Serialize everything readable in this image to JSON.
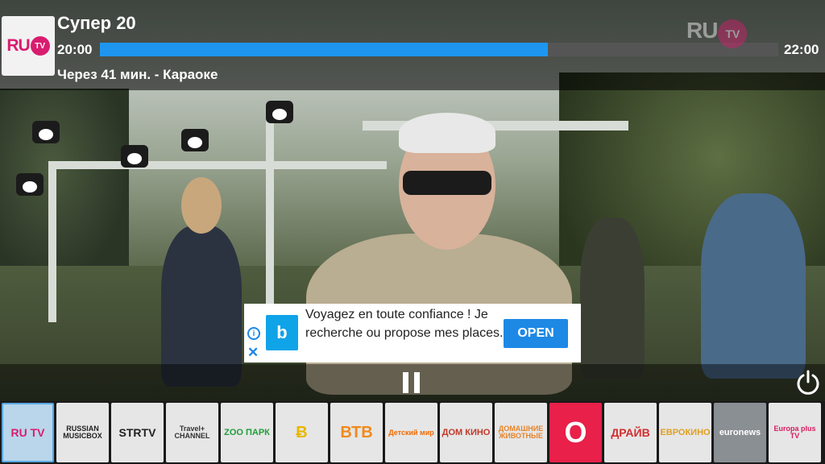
{
  "player": {
    "channel_logo": {
      "ru": "RU",
      "tv": "TV"
    },
    "program_title": "Супер 20",
    "time_start": "20:00",
    "time_end": "22:00",
    "progress": 0.66,
    "next_up": "Через 41 мин. - Караоке",
    "watermark": {
      "ru": "RU",
      "tv": "TV"
    }
  },
  "ad": {
    "info_icon": "i",
    "close_icon": "✕",
    "app_icon_letter": "b",
    "text": "Voyagez en toute confiance ! Je recherche ou propose mes places.",
    "cta": "OPEN"
  },
  "controls": {
    "pause_icon": "pause-icon",
    "power_icon": "power-icon"
  },
  "channels": [
    {
      "name": "RU TV",
      "color": "#d91c6f"
    },
    {
      "name": "RUSSIAN MUSICBOX",
      "color": "#222222"
    },
    {
      "name": "STRTV",
      "color": "#222222"
    },
    {
      "name": "Travel+ CHANNEL",
      "color": "#333333"
    },
    {
      "name": "ZOO ПАРК",
      "color": "#1f9e3a"
    },
    {
      "name": "Ƀ",
      "color": "#e8b800"
    },
    {
      "name": "ВТВ",
      "color": "#f08a1c"
    },
    {
      "name": "Детский мир",
      "color": "#f06a00"
    },
    {
      "name": "ДОМ КИНО",
      "color": "#c0392b"
    },
    {
      "name": "ДОМАШНИЕ ЖИВОТНЫЕ",
      "color": "#e8842c"
    },
    {
      "name": "O",
      "color": "#e8204a"
    },
    {
      "name": "ДРАЙВ",
      "color": "#d32f2f"
    },
    {
      "name": "ЕВРОКИНО",
      "color": "#e0a020"
    },
    {
      "name": "euronews",
      "color": "#ffffff"
    },
    {
      "name": "Europa plus TV",
      "color": "#d81b60"
    }
  ]
}
